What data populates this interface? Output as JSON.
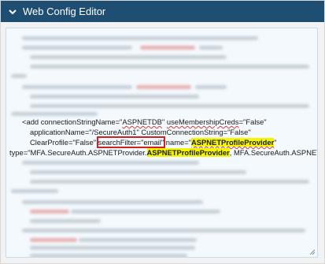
{
  "header": {
    "title": "Web Config Editor",
    "toggle_icon": "chevron-down-icon"
  },
  "editor": {
    "line1": {
      "a": "<add connectionStringName=\"",
      "b": "ASPNETDB",
      "c": "\" ",
      "d": "useMembershipCreds",
      "e": "=\"False\""
    },
    "line2": "applicationName=\"/SecureAuth1\" CustomConnectionString=\"False\"",
    "line3": {
      "a": "ClearProfile=\"False\" ",
      "b": "searchFilter=\"email\"",
      "c": " name=\"",
      "d": "ASPNETProfileProvider",
      "e": "\""
    },
    "line4": {
      "a": "type=\"MFA.SecureAuth.ASPNETProvider.",
      "b": "ASPNETProfileProvider",
      "c": ", MFA.SecureAuth.ASPNETProvider\" />"
    },
    "resize_icon": "resize-grip-icon"
  }
}
